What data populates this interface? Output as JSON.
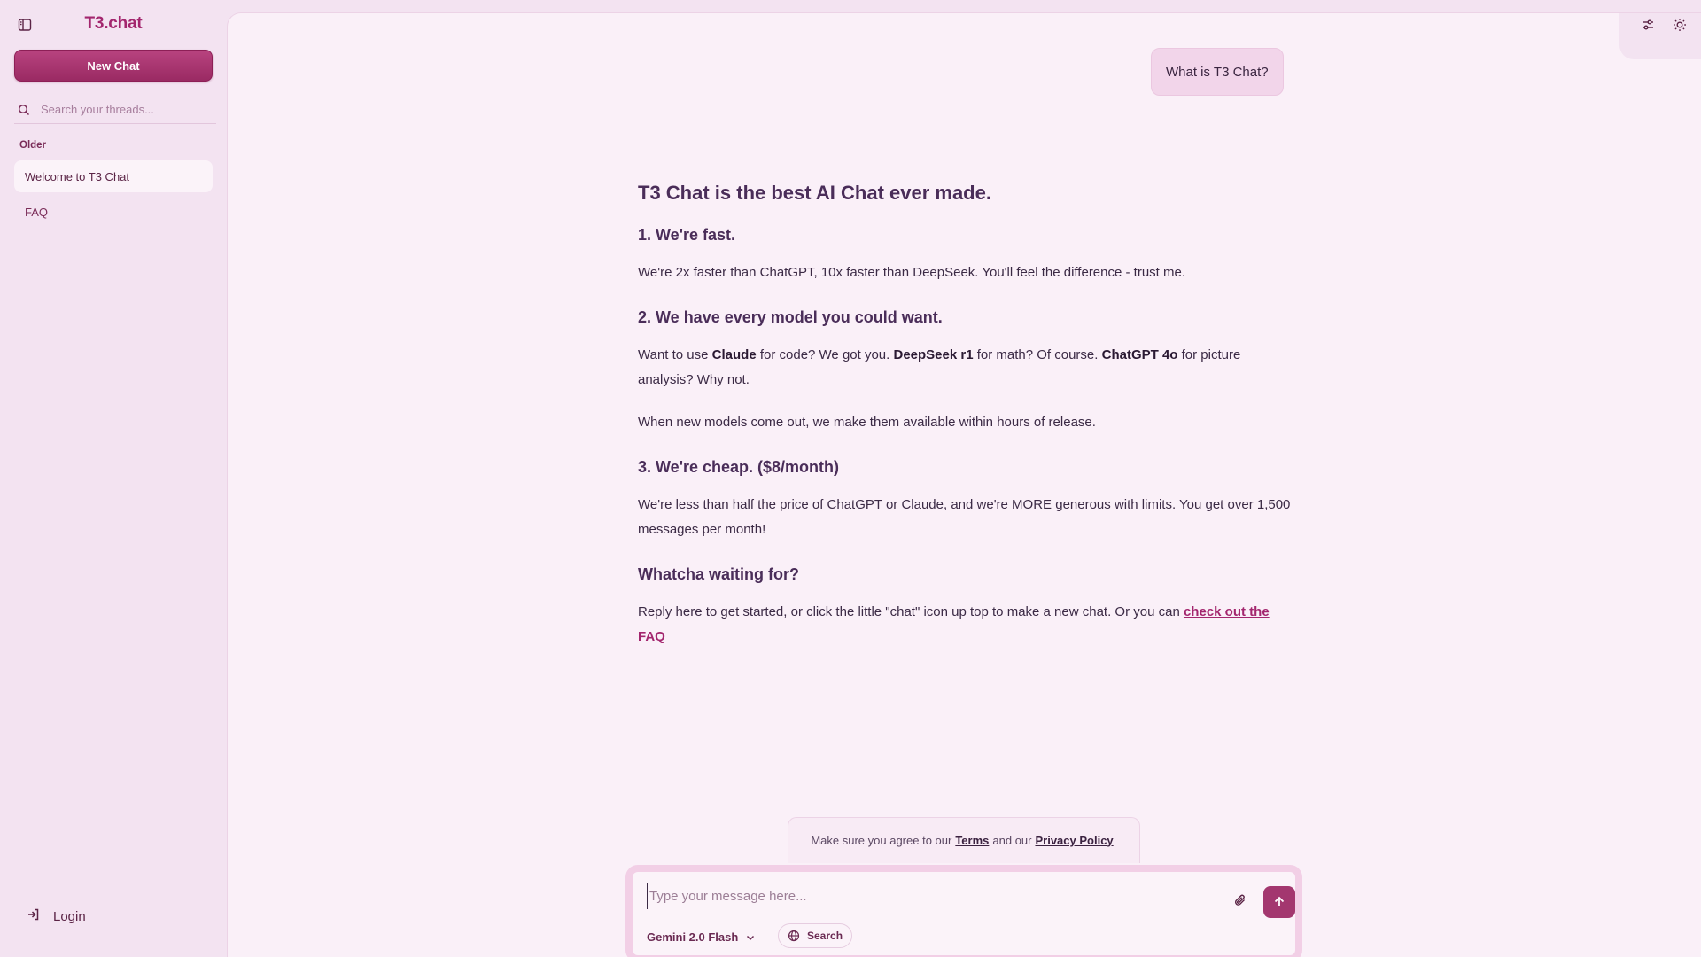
{
  "sidebar": {
    "brand": "T3.chat",
    "new_chat_label": "New Chat",
    "search_placeholder": "Search your threads...",
    "group_label": "Older",
    "threads": [
      {
        "label": "Welcome to T3 Chat",
        "active": true
      },
      {
        "label": "FAQ",
        "active": false
      }
    ],
    "login_label": "Login"
  },
  "header": {
    "icons": [
      "settings-sliders-icon",
      "theme-sun-icon"
    ]
  },
  "chat": {
    "user_message": "What is T3 Chat?",
    "response": {
      "title": "T3 Chat is the best AI Chat ever made.",
      "s1_heading": "1. We're fast.",
      "s1_text": "We're 2x faster than ChatGPT, 10x faster than DeepSeek. You'll feel the difference - trust me.",
      "s2_heading": "2. We have every model you could want.",
      "s2_t1": "Want to use ",
      "s2_b1": "Claude",
      "s2_t2": " for code? We got you. ",
      "s2_b2": "DeepSeek r1",
      "s2_t3": " for math? Of course. ",
      "s2_b3": "ChatGPT 4o",
      "s2_t4": " for picture analysis? Why not.",
      "s2_text2": "When new models come out, we make them available within hours of release.",
      "s3_heading": "3. We're cheap. ($8/month)",
      "s3_text": "We're less than half the price of ChatGPT or Claude, and we're MORE generous with limits. You get over 1,500 messages per month!",
      "s4_heading": "Whatcha waiting for?",
      "s4_text": "Reply here to get started, or click the little \"chat\" icon up top to make a new chat. Or you can ",
      "s4_link": "check out the FAQ"
    }
  },
  "terms": {
    "prefix": "Make sure you agree to our",
    "terms_link": "Terms",
    "middle": "and our",
    "privacy_link": "Privacy Policy"
  },
  "composer": {
    "placeholder": "Type your message here...",
    "model": "Gemini 2.0 Flash",
    "search_label": "Search"
  },
  "colors": {
    "accent": "#a3266e",
    "sidebar_bg": "#f3e3f1",
    "main_bg": "#faf0f8"
  }
}
